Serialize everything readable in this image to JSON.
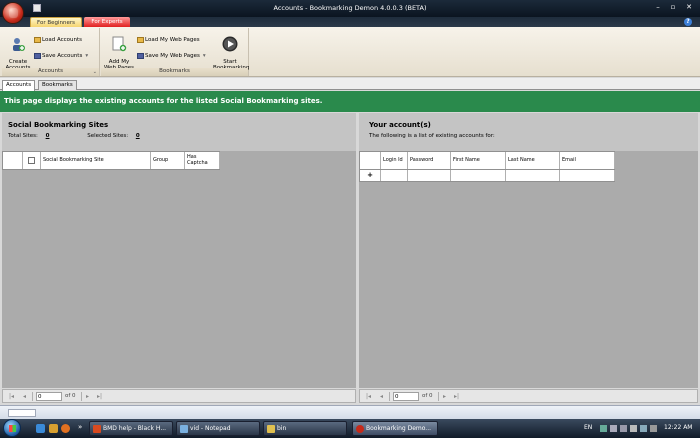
{
  "window": {
    "title": "Accounts - Bookmarking Demon 4.0.0.3 (BETA)"
  },
  "ribbon_tabs": [
    "For Beginners",
    "For Experts"
  ],
  "ribbon": {
    "groups": [
      {
        "label": "Accounts",
        "big": "Create\nAccounts",
        "small1": "Load Accounts",
        "small2": "Save Accounts"
      },
      {
        "label": "Bookmarks",
        "big1": "Add My\nWeb Pages",
        "small1": "Load My Web Pages",
        "small2": "Save My Web Pages",
        "big2": "Start\nBookmarking"
      }
    ]
  },
  "doc_tabs": [
    "Accounts",
    "Bookmarks"
  ],
  "banner": "This page displays the existing accounts for the listed Social Bookmarking sites.",
  "left": {
    "title": "Social Bookmarking Sites",
    "total_label": "Total Sites:",
    "total_value": "0",
    "selected_label": "Selected Sites:",
    "selected_value": "0",
    "columns": [
      "Social Bookmarking Site",
      "Group",
      "Has Captcha"
    ],
    "nav": {
      "position": "0",
      "of": "of 0"
    }
  },
  "right": {
    "title": "Your account(s)",
    "subtitle": "The following is a list of existing accounts for:",
    "columns": [
      "Login Id",
      "Password",
      "First Name",
      "Last Name",
      "Email"
    ],
    "new_row_marker": "+",
    "nav": {
      "position": "0",
      "of": "of 0"
    }
  },
  "taskbar": {
    "tasks": [
      "BMD help - Black H...",
      "vid - Notepad",
      "bin",
      "Bookmarking Demo..."
    ],
    "lang": "EN",
    "clock": "12:22 AM"
  },
  "colors": {
    "banner": "#2a8a4c",
    "experts_tab": "#e02020",
    "beginners_tab": "#f5d470"
  }
}
